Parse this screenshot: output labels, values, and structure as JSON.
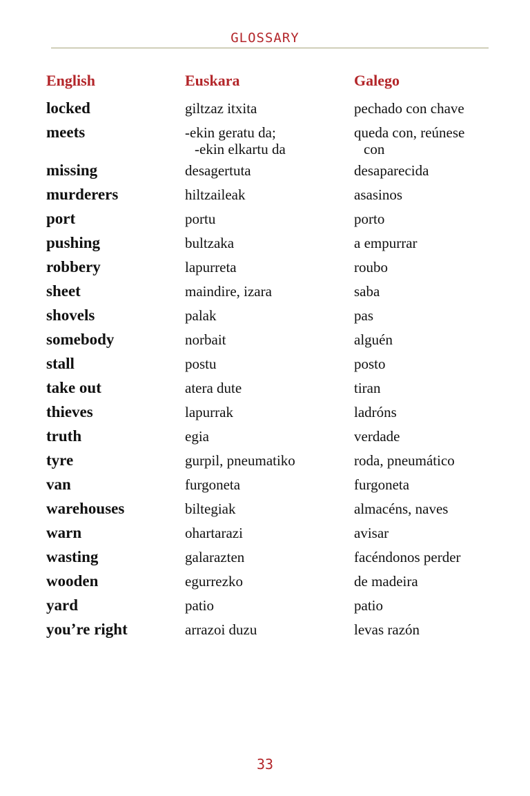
{
  "header": {
    "title": "GLOSSARY"
  },
  "columns": {
    "english": "English",
    "euskara": "Euskara",
    "galego": "Galego"
  },
  "entries": [
    {
      "english": "locked",
      "euskara": [
        "giltzaz itxita"
      ],
      "galego": [
        "pechado con chave"
      ]
    },
    {
      "english": "meets",
      "euskara": [
        "-ekin geratu da;",
        "-ekin elkartu da"
      ],
      "galego": [
        "queda con, reúnese",
        "con"
      ]
    },
    {
      "english": "missing",
      "euskara": [
        "desagertuta"
      ],
      "galego": [
        "desaparecida"
      ]
    },
    {
      "english": "murderers",
      "euskara": [
        "hiltzaileak"
      ],
      "galego": [
        "asasinos"
      ]
    },
    {
      "english": "port",
      "euskara": [
        "portu"
      ],
      "galego": [
        "porto"
      ]
    },
    {
      "english": "pushing",
      "euskara": [
        "bultzaka"
      ],
      "galego": [
        "a empurrar"
      ]
    },
    {
      "english": "robbery",
      "euskara": [
        "lapurreta"
      ],
      "galego": [
        "roubo"
      ]
    },
    {
      "english": "sheet",
      "euskara": [
        "maindire, izara"
      ],
      "galego": [
        "saba"
      ]
    },
    {
      "english": "shovels",
      "euskara": [
        "palak"
      ],
      "galego": [
        "pas"
      ]
    },
    {
      "english": "somebody",
      "euskara": [
        "norbait"
      ],
      "galego": [
        "alguén"
      ]
    },
    {
      "english": "stall",
      "euskara": [
        "postu"
      ],
      "galego": [
        "posto"
      ]
    },
    {
      "english": "take out",
      "euskara": [
        "atera dute"
      ],
      "galego": [
        "tiran"
      ]
    },
    {
      "english": "thieves",
      "euskara": [
        "lapurrak"
      ],
      "galego": [
        "ladróns"
      ]
    },
    {
      "english": "truth",
      "euskara": [
        "egia"
      ],
      "galego": [
        "verdade"
      ]
    },
    {
      "english": "tyre",
      "euskara": [
        "gurpil, pneumatiko"
      ],
      "galego": [
        "roda, pneumático"
      ]
    },
    {
      "english": "van",
      "euskara": [
        "furgoneta"
      ],
      "galego": [
        "furgoneta"
      ]
    },
    {
      "english": "warehouses",
      "euskara": [
        "biltegiak"
      ],
      "galego": [
        "almacéns, naves"
      ]
    },
    {
      "english": "warn",
      "euskara": [
        "ohartarazi"
      ],
      "galego": [
        "avisar"
      ]
    },
    {
      "english": "wasting",
      "euskara": [
        "galarazten"
      ],
      "galego": [
        "facéndonos perder"
      ]
    },
    {
      "english": "wooden",
      "euskara": [
        "egurrezko"
      ],
      "galego": [
        "de madeira"
      ]
    },
    {
      "english": "yard",
      "euskara": [
        "patio"
      ],
      "galego": [
        "patio"
      ]
    },
    {
      "english": "you’re right",
      "euskara": [
        "arrazoi duzu"
      ],
      "galego": [
        "levas razón"
      ]
    }
  ],
  "footer": {
    "page_number": "33"
  },
  "colors": {
    "accent": "#b3262a",
    "rule": "#a7a37a",
    "text": "#111111"
  }
}
